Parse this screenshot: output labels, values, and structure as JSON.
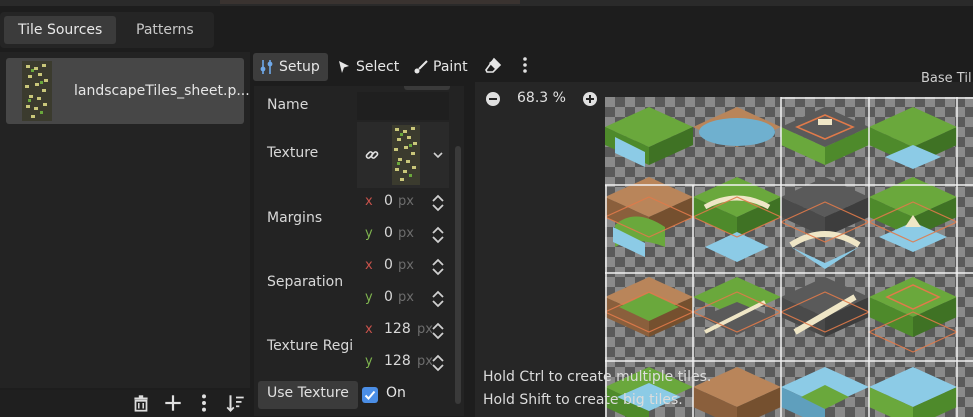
{
  "tabs": [
    {
      "label": "Tile Sources",
      "active": true
    },
    {
      "label": "Patterns",
      "active": false
    }
  ],
  "sources": [
    {
      "label": "landscapeTiles_sheet.p..."
    }
  ],
  "bottom_bar": {
    "icons": [
      "trash-icon",
      "plus-icon",
      "kebab-menu-icon",
      "sort-icon"
    ]
  },
  "toolbar": {
    "setup": "Setup",
    "select": "Select",
    "paint": "Paint",
    "icons": [
      "setup-icon",
      "cursor-icon",
      "paint-brush-icon",
      "eraser-icon",
      "kebab-menu-icon"
    ]
  },
  "inspector": {
    "name_label": "Name",
    "texture_label": "Texture",
    "margins_label": "Margins",
    "separation_label": "Separation",
    "texture_region_label": "Texture Regi",
    "use_texture_label": "Use Texture",
    "margins": {
      "x": "0",
      "y": "0",
      "unit": "px"
    },
    "separation": {
      "x": "0",
      "y": "0",
      "unit": "px"
    },
    "texture_region": {
      "x": "128",
      "y": "128",
      "unit": "px"
    },
    "use_texture": {
      "checked": true,
      "label": "On"
    }
  },
  "atlas": {
    "zoom": "68.3 %",
    "corner_label": "Base Til",
    "hint_ctrl": "Hold Ctrl to create multiple tiles.",
    "hint_shift": "Hold Shift to create big tiles."
  },
  "colors": {
    "accent": "#4b8ee6",
    "axis_x": "#c8524b",
    "axis_y": "#7fb44f",
    "tile_outline": "#e07a4a",
    "grass": "#6aa83c",
    "dirt": "#b9855a",
    "water": "#8ccbe6",
    "road": "#5a5a5a"
  }
}
